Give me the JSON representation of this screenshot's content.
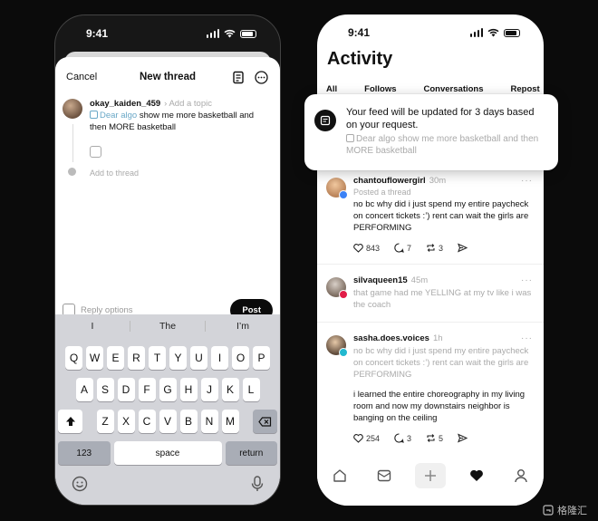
{
  "left_phone": {
    "status_time": "9:41",
    "header": {
      "cancel_label": "Cancel",
      "title": "New thread"
    },
    "compose": {
      "username": "okay_kaiden_459",
      "topic_placeholder": "Add a topic",
      "algo_prefix": "Dear algo",
      "text": "show me more basketball and then MORE basketball",
      "add_to_thread": "Add to thread"
    },
    "reply_options_label": "Reply options",
    "post_label": "Post",
    "keyboard": {
      "suggestions": [
        "I",
        "The",
        "I’m"
      ],
      "row1": [
        "Q",
        "W",
        "E",
        "R",
        "T",
        "Y",
        "U",
        "I",
        "O",
        "P"
      ],
      "row2": [
        "A",
        "S",
        "D",
        "F",
        "G",
        "H",
        "J",
        "K",
        "L"
      ],
      "row3": [
        "Z",
        "X",
        "C",
        "V",
        "B",
        "N",
        "M"
      ],
      "num_label": "123",
      "space_label": "space",
      "return_label": "return"
    }
  },
  "right_phone": {
    "status_time": "9:41",
    "title": "Activity",
    "tabs": [
      "All",
      "Follows",
      "Conversations",
      "Repost"
    ],
    "toast": {
      "message": "Your feed will be updated for 3 days based on your request.",
      "algo_prefix": "Dear algo",
      "sub": "show me more basketball and then MORE basketball"
    },
    "posts": [
      {
        "username": "chantouflowergirl",
        "time": "30m",
        "subtitle": "Posted a thread",
        "text": "no bc why did i just spend my entire paycheck on concert tickets :’) rent can wait the girls are PERFORMING",
        "likes": "843",
        "replies": "7",
        "reposts": "3",
        "badge_color": "#3b82f6"
      },
      {
        "username": "silvaqueen15",
        "time": "45m",
        "quote": "that game had me YELLING at my tv like i was the coach",
        "badge_color": "#e11d48"
      },
      {
        "username": "sasha.does.voices",
        "time": "1h",
        "quote": "no bc why did i just spend my entire paycheck on concert tickets :’) rent can wait the girls are PERFORMING",
        "text": "i learned the entire choreography in my living room and now my downstairs neighbor is banging on the ceiling",
        "likes": "254",
        "replies": "3",
        "reposts": "5",
        "badge_color": "#22b8cf"
      }
    ]
  },
  "watermark": "格隆汇"
}
